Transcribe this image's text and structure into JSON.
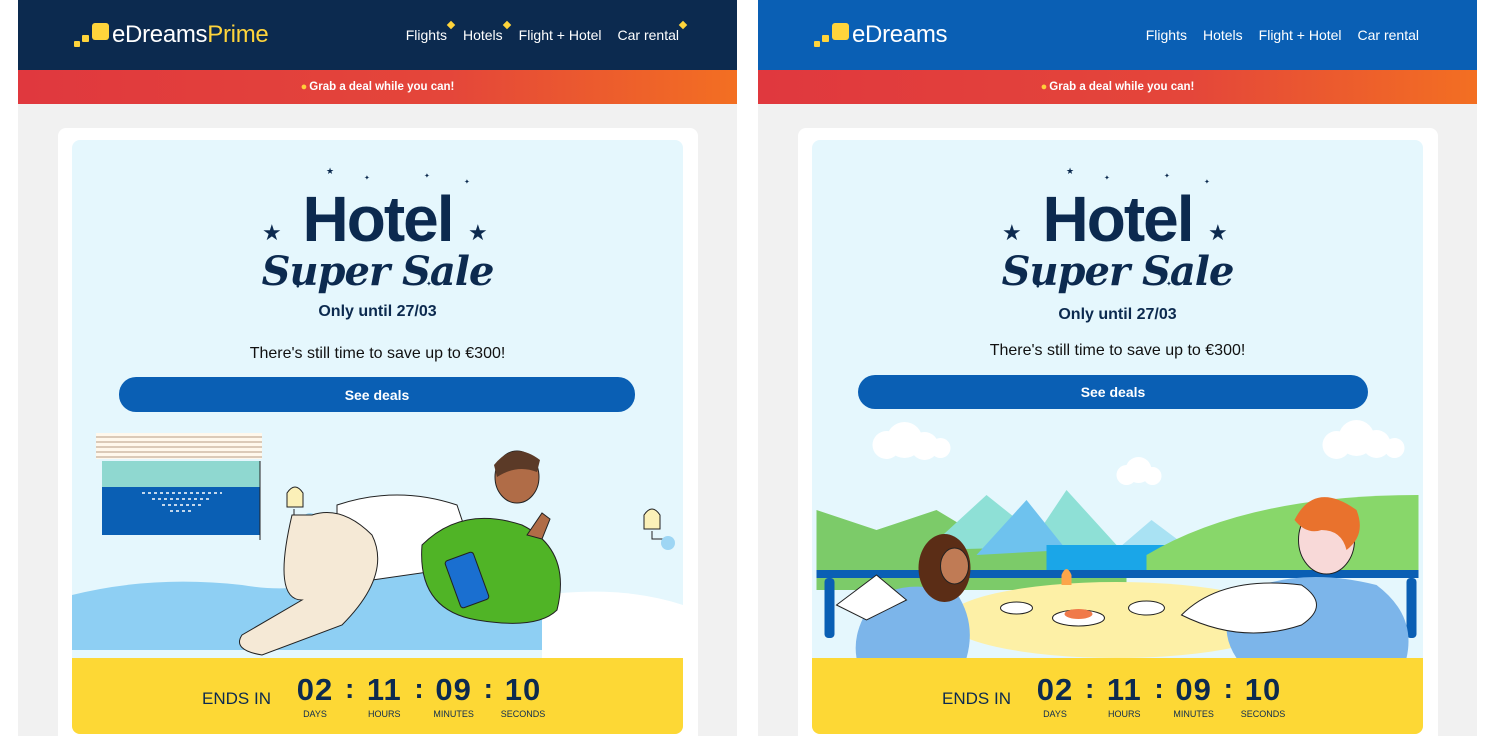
{
  "prime": {
    "logo_text": "eDreams",
    "logo_suffix": "Prime",
    "nav": [
      {
        "label": "Flights",
        "badge": true
      },
      {
        "label": "Hotels",
        "badge": true
      },
      {
        "label": "Flight + Hotel",
        "badge": false
      },
      {
        "label": "Car rental",
        "badge": true
      }
    ]
  },
  "standard": {
    "logo_text": "eDreams",
    "nav": [
      {
        "label": "Flights"
      },
      {
        "label": "Hotels"
      },
      {
        "label": "Flight + Hotel"
      },
      {
        "label": "Car rental"
      }
    ]
  },
  "banner_text": "Grab a deal while you can!",
  "sale": {
    "title_line1": "Hotel",
    "title_line2": "Super Sale",
    "until": "Only until 27/03",
    "subtitle": "There's still time to save up to €300!",
    "cta_label": "See deals"
  },
  "countdown": {
    "label": "ENDS IN",
    "days": "02",
    "days_label": "DAYS",
    "hours": "11",
    "hours_label": "HOURS",
    "minutes": "09",
    "minutes_label": "MINUTES",
    "seconds": "10",
    "seconds_label": "SECONDS"
  },
  "colors": {
    "prime_header": "#0c2a4f",
    "standard_header": "#0a5fb4",
    "brand_yellow": "#ffd43b",
    "cta_blue": "#0a5fb4",
    "countdown_bg": "#fdd835"
  }
}
